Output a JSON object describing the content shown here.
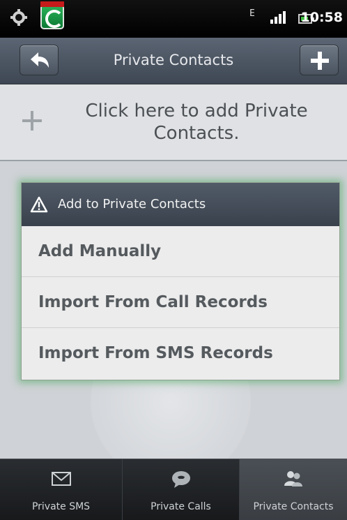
{
  "status_bar": {
    "time": "10:58",
    "network_type": "E",
    "icons": [
      "settings-notification-icon",
      "comodo-app-icon",
      "signal-icon",
      "battery-icon"
    ]
  },
  "header": {
    "title": "Private Contacts",
    "back_icon": "back-arrow-icon",
    "add_icon": "plus-icon"
  },
  "add_row": {
    "text": "Click here to add Private Contacts."
  },
  "dialog": {
    "title": "Add to Private Contacts",
    "icon": "warning-icon",
    "items": [
      {
        "label": "Add Manually"
      },
      {
        "label": "Import From Call Records"
      },
      {
        "label": "Import From SMS Records"
      }
    ]
  },
  "tabs": [
    {
      "label": "Private SMS",
      "icon": "envelope-icon",
      "selected": false
    },
    {
      "label": "Private Calls",
      "icon": "phone-bubble-icon",
      "selected": false
    },
    {
      "label": "Private Contacts",
      "icon": "contacts-icon",
      "selected": true
    }
  ],
  "colors": {
    "dialog_glow": "#50aa64",
    "header_bg": "#4a535f",
    "selected_tab_bg": "#42464b"
  }
}
